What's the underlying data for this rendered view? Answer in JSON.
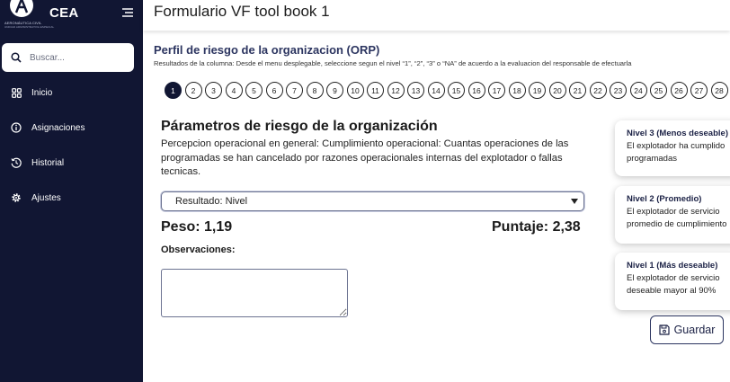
{
  "sidebar": {
    "brand": "CEA",
    "logo_caption": "AERONÁUTICA CIVIL",
    "logo_subcaption": "UNIDAD ADMINISTRATIVA ESPECIAL",
    "search_placeholder": "Buscar...",
    "items": [
      {
        "label": "Inicio",
        "icon": "grid-icon"
      },
      {
        "label": "Asignaciones",
        "icon": "info-icon"
      },
      {
        "label": "Historial",
        "icon": "history-icon"
      },
      {
        "label": "Ajustes",
        "icon": "gear-icon"
      }
    ]
  },
  "header": {
    "title": "Formulario VF tool book 1"
  },
  "section": {
    "title": "Perfil de riesgo de la organizacion (ORP)",
    "subtitle": "Resultados de la columna: Desde el menu desplegable, seleccione segun el nivel “1”, “2”, “3” o “NA” de acuerdo a la evaluacion del responsable de efectuarla"
  },
  "steps": [
    "1",
    "2",
    "3",
    "4",
    "5",
    "6",
    "7",
    "8",
    "9",
    "10",
    "11",
    "12",
    "13",
    "14",
    "15",
    "16",
    "17",
    "18",
    "19",
    "20",
    "21",
    "22",
    "23",
    "24",
    "25",
    "26",
    "27",
    "28"
  ],
  "active_step": "1",
  "parameter": {
    "title": "Párametros de riesgo de la organización",
    "description": "Percepcion operacional en general: Cumplimiento operacional: Cuantas operaciones de las programadas se han cancelado por razones operacionales internas del explotador o fallas tecnicas.",
    "select_value": "Resultado: Nivel",
    "peso": "Peso: 1,19",
    "puntaje": "Puntaje: 2,38",
    "observaciones_label": "Observaciones:",
    "observaciones_value": ""
  },
  "levels": [
    {
      "title": "Nivel 3 (Menos deseable)",
      "lines": [
        "El explotador ha cumplido",
        "programadas"
      ]
    },
    {
      "title": "Nivel 2 (Promedio)",
      "lines": [
        "El explotador de servicio",
        "promedio de cumplimiento"
      ]
    },
    {
      "title": "Nivel 1 (Más deseable)",
      "lines": [
        "El explotador de servicio",
        "deseable mayor al 90%"
      ]
    }
  ],
  "actions": {
    "save_label": "Guardar"
  },
  "colors": {
    "sidebar_bg": "#111633",
    "accent": "#2c3560",
    "active_step": "#111633"
  }
}
